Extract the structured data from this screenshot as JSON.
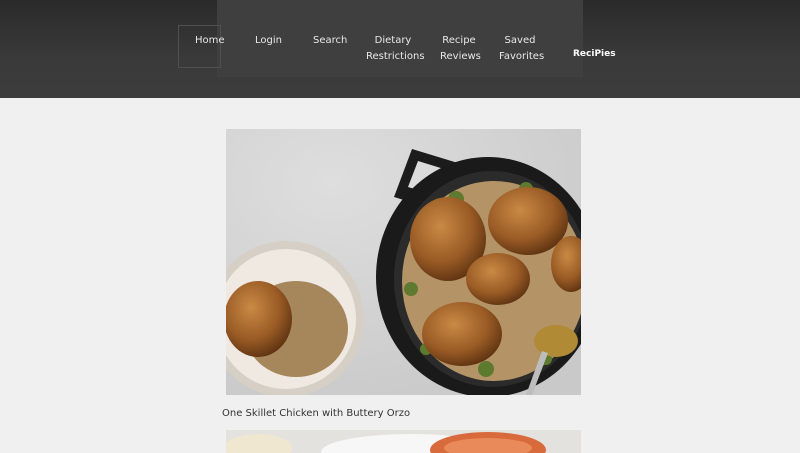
{
  "nav": {
    "home": "Home",
    "login": "Login",
    "search": "Search",
    "dietary_line1": "Dietary",
    "dietary_line2": "Restrictions",
    "reviews_line1": "Recipe",
    "reviews_line2": "Reviews",
    "saved_line1": "Saved",
    "saved_line2": "Favorites"
  },
  "brand": "ReciPies",
  "recipes": [
    {
      "title": "One Skillet Chicken with Buttery Orzo",
      "image": "chicken-orzo-skillet-photo"
    },
    {
      "title": "",
      "image": "second-recipe-photo"
    }
  ]
}
